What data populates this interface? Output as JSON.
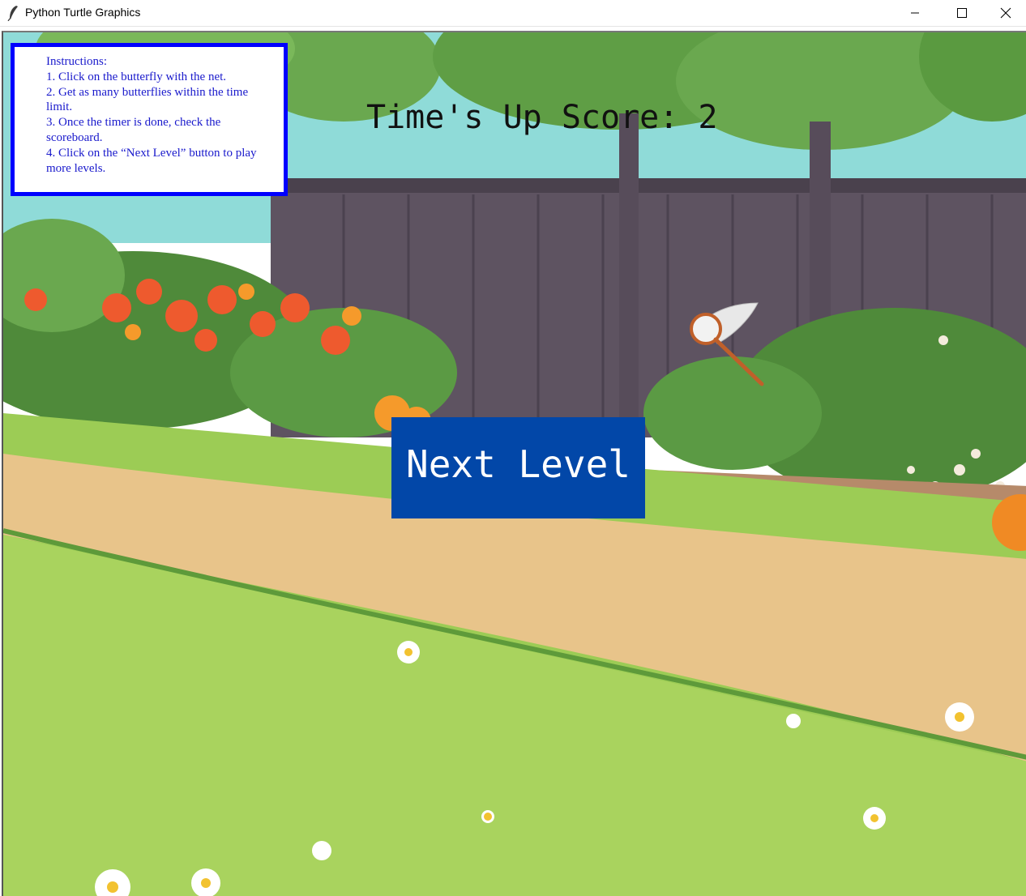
{
  "window": {
    "title": "Python Turtle Graphics",
    "controls": {
      "minimize": "minimize-icon",
      "maximize": "maximize-icon",
      "close": "close-icon"
    }
  },
  "instructions": {
    "text": "Instructions:\n1. Click on the butterfly with the net.\n2. Get as many butterflies within the time limit.\n3. Once the timer is done, check the scoreboard.\n4. Click on the “Next Level” button to play more levels.",
    "border_color": "#0000ff",
    "text_color": "#1a1acc"
  },
  "status": {
    "score_text": "Time's Up Score: 2"
  },
  "next_level_button": {
    "label": "Next Level",
    "background": "#0247a8"
  },
  "cursor": {
    "icon": "butterfly-net-icon"
  },
  "colors": {
    "sky": "#8fdbd8",
    "fence": "#5e5361",
    "grass": "#9ccc55",
    "path": "#e8c48a"
  }
}
